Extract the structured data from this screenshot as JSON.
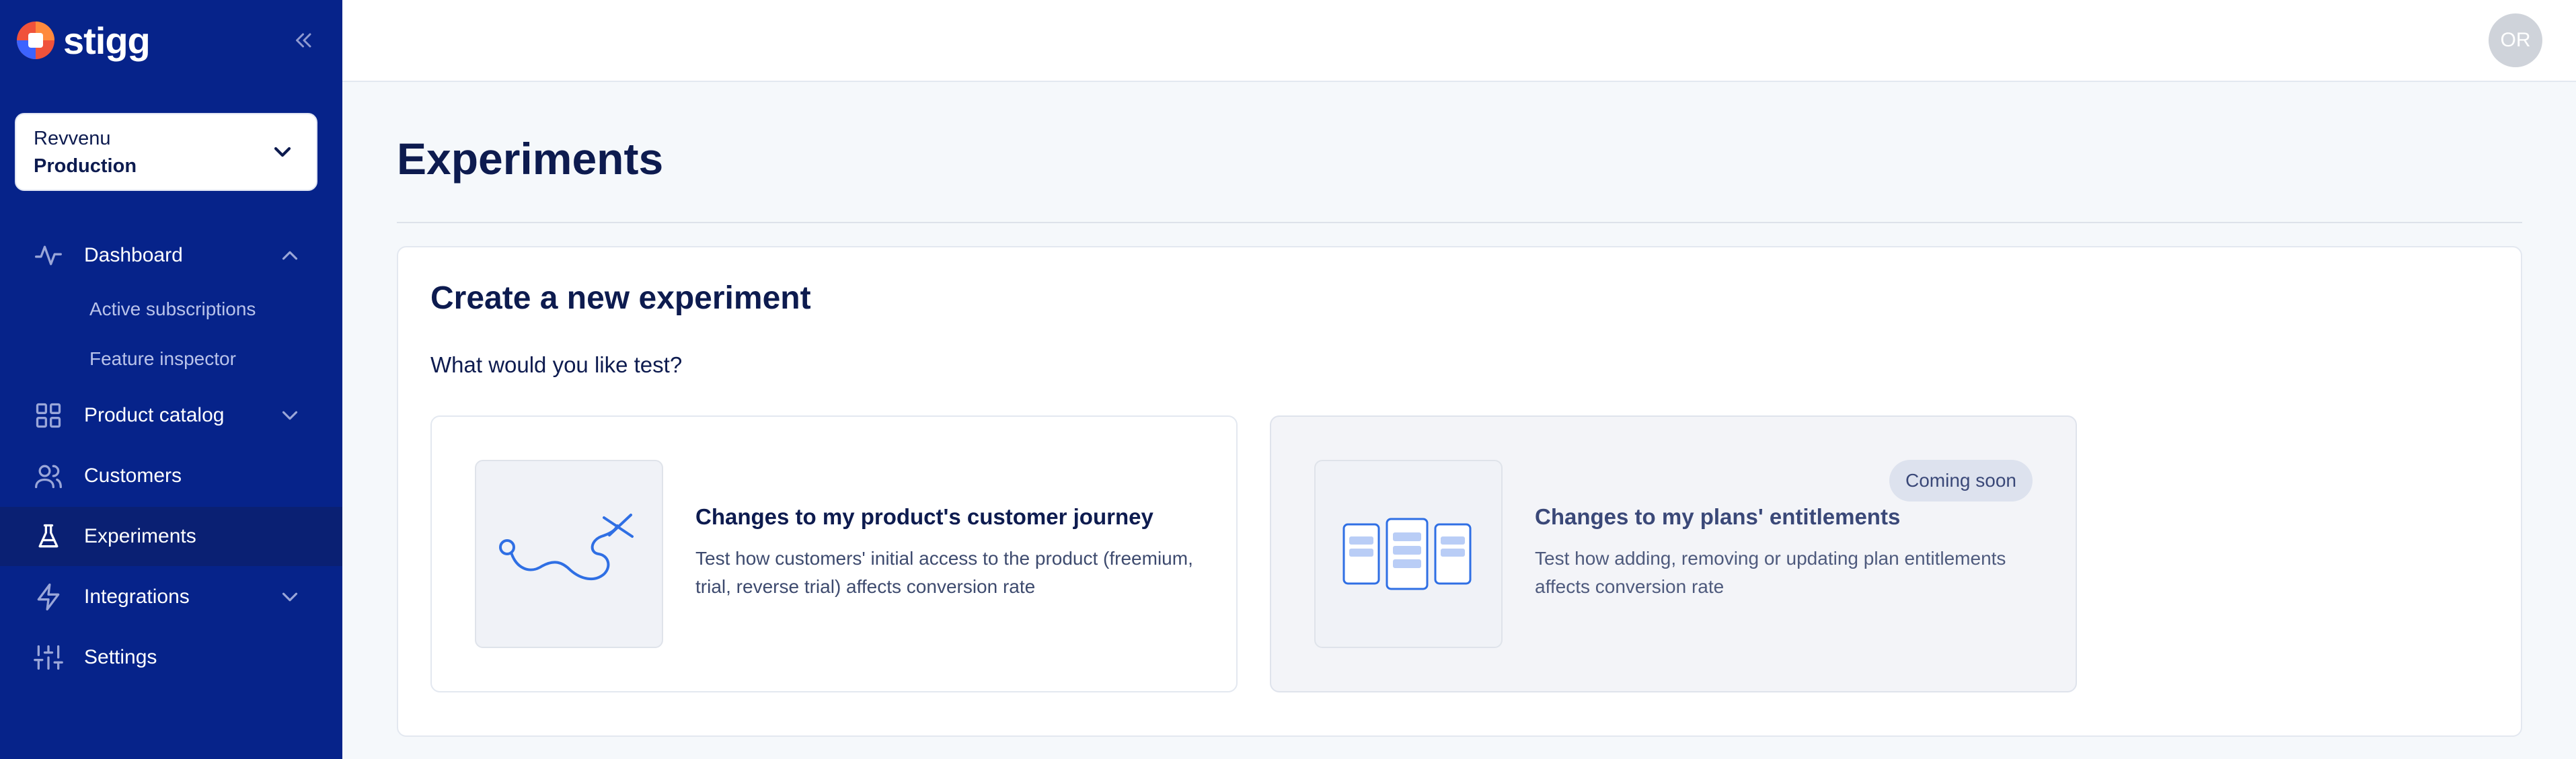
{
  "brand": {
    "name": "stigg"
  },
  "environment": {
    "org": "Revvenu",
    "name": "Production"
  },
  "nav": {
    "dashboard": "Dashboard",
    "dashboard_sub": [
      "Active subscriptions",
      "Feature inspector"
    ],
    "product_catalog": "Product catalog",
    "customers": "Customers",
    "experiments": "Experiments",
    "integrations": "Integrations",
    "settings": "Settings"
  },
  "user": {
    "initials": "OR"
  },
  "page": {
    "title": "Experiments"
  },
  "panel": {
    "title": "Create a new experiment",
    "question": "What would you like test?",
    "cards": [
      {
        "title": "Changes to my product's customer journey",
        "desc": "Test how customers' initial access to the product (freemium, trial, reverse trial) affects conversion rate"
      },
      {
        "title": "Changes to my plans' entitlements",
        "desc": "Test how adding, removing or updating plan entitlements affects conversion rate",
        "badge": "Coming soon"
      }
    ]
  },
  "colors": {
    "sidebar": "#06238a",
    "accent": "#2f6fe4",
    "text": "#0d1b4f"
  },
  "icons": [
    "stigg-logo-icon",
    "collapse-icon",
    "chevron-down-icon",
    "activity-icon",
    "chevron-up-icon",
    "grid-icon",
    "users-icon",
    "flask-icon",
    "zap-icon",
    "sliders-icon"
  ]
}
